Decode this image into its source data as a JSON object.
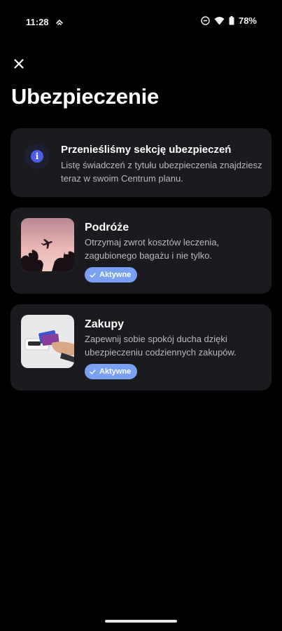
{
  "status_bar": {
    "time": "11:28",
    "battery": "78%",
    "icons": [
      "notification-icon",
      "do-not-disturb-icon",
      "wifi-icon",
      "battery-icon"
    ]
  },
  "header": {
    "close_icon": "close-icon",
    "title": "Ubezpieczenie"
  },
  "info_card": {
    "icon": "info-icon",
    "title": "Przenieśliśmy sekcję ubezpieczeń",
    "body": "Listę świadczeń z tytułu ubezpieczenia znajdziesz teraz w swoim Centrum planu."
  },
  "products": [
    {
      "title": "Podróże",
      "description": "Otrzymaj zwrot kosztów leczenia, zagubionego bagażu i nie tylko.",
      "badge": "Aktywne",
      "image": "airplane-sunset-image"
    },
    {
      "title": "Zakupy",
      "description": "Zapewnij sobie spokój ducha dzięki ubezpieczeniu codziennych zakupów.",
      "badge": "Aktywne",
      "image": "card-payment-terminal-image"
    }
  ],
  "colors": {
    "background": "#000000",
    "card": "#1b1b1f",
    "badge": "#7aa0f2",
    "info_icon": "#4b5fe6",
    "secondary_text": "#b8b8be"
  }
}
